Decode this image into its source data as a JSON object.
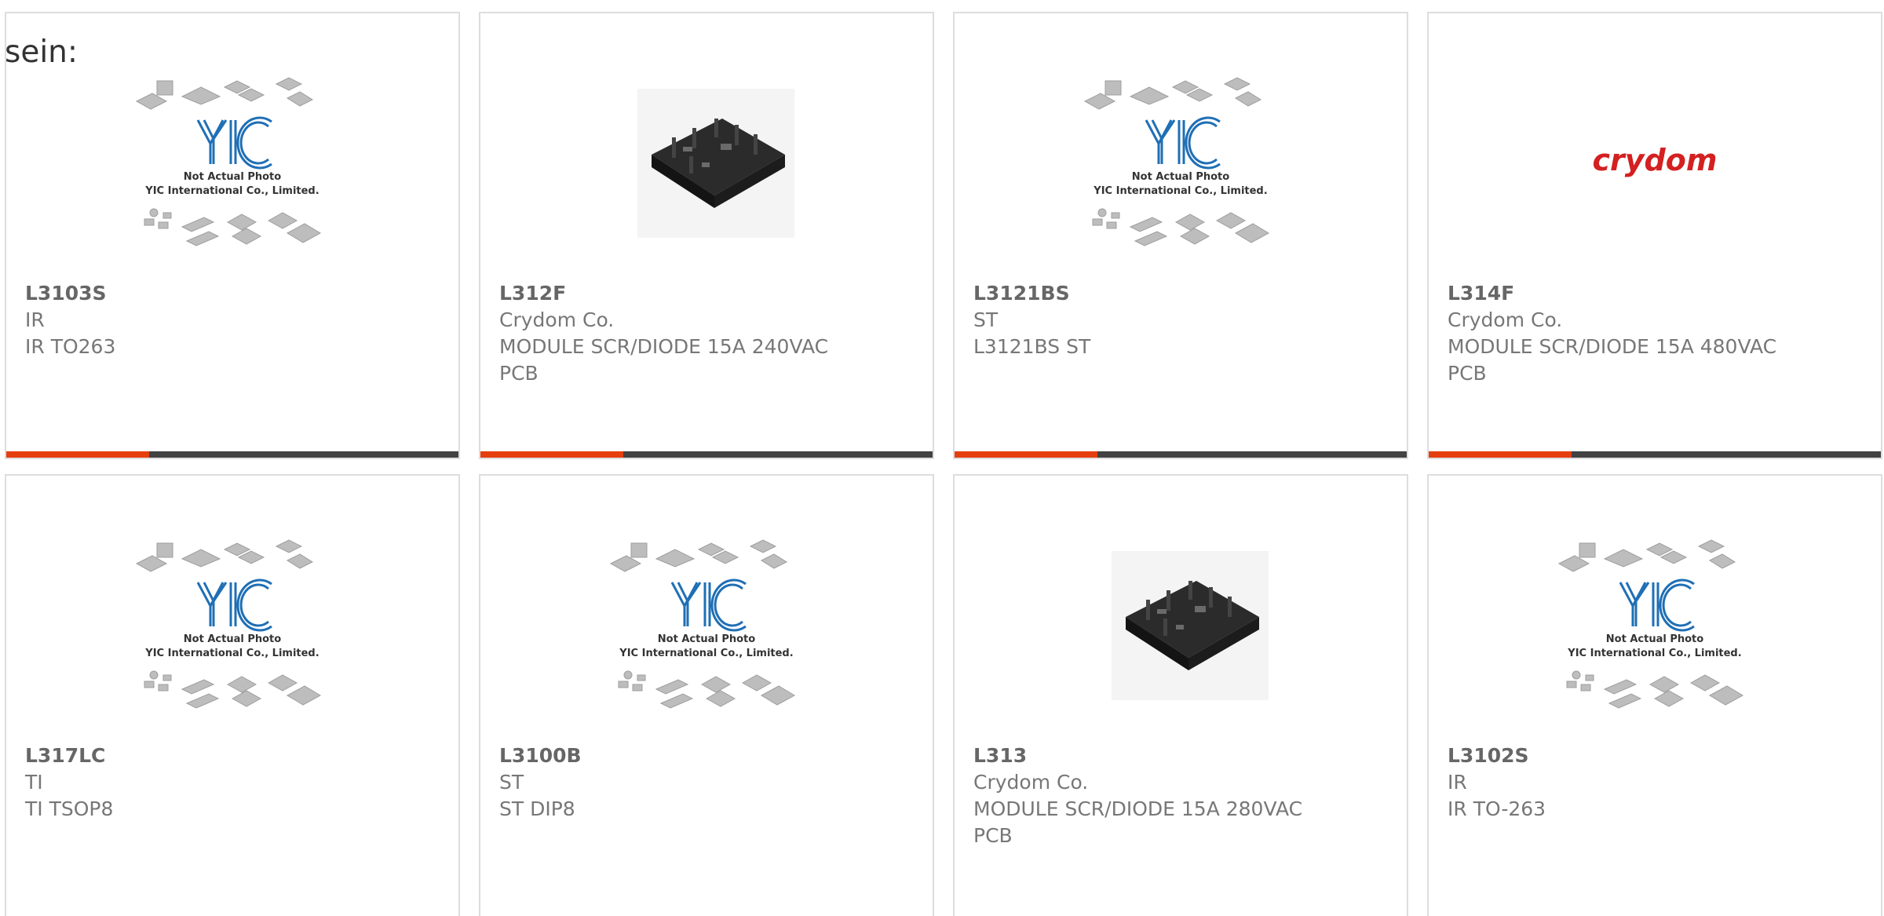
{
  "intro_text": "sein:",
  "colors": {
    "accent": "#e53f0f",
    "bar": "#424242",
    "border": "#dddddd",
    "yic_logo": "#1f6fb5",
    "crydom_logo": "#d42020"
  },
  "placeholder": {
    "line1": "Not Actual Photo",
    "line2": "YIC International Co., Limited."
  },
  "crydom_logo_text": "crydom",
  "products": [
    {
      "part": "L3103S",
      "manufacturer": "IR",
      "description": [
        "IR TO263"
      ],
      "image": "yic-placeholder"
    },
    {
      "part": "L312F",
      "manufacturer": "Crydom Co.",
      "description": [
        "MODULE SCR/DIODE 15A 240VAC",
        "PCB"
      ],
      "image": "module-photo"
    },
    {
      "part": "L3121BS",
      "manufacturer": "ST",
      "description": [
        "L3121BS ST"
      ],
      "image": "yic-placeholder"
    },
    {
      "part": "L314F",
      "manufacturer": "Crydom Co.",
      "description": [
        "MODULE SCR/DIODE 15A 480VAC",
        "PCB"
      ],
      "image": "crydom-logo"
    },
    {
      "part": "L317LC",
      "manufacturer": "TI",
      "description": [
        "TI TSOP8"
      ],
      "image": "yic-placeholder"
    },
    {
      "part": "L3100B",
      "manufacturer": "ST",
      "description": [
        "ST DIP8"
      ],
      "image": "yic-placeholder"
    },
    {
      "part": "L313",
      "manufacturer": "Crydom Co.",
      "description": [
        "MODULE SCR/DIODE 15A 280VAC",
        "PCB"
      ],
      "image": "module-photo"
    },
    {
      "part": "L3102S",
      "manufacturer": "IR",
      "description": [
        "IR TO-263"
      ],
      "image": "yic-placeholder"
    }
  ]
}
